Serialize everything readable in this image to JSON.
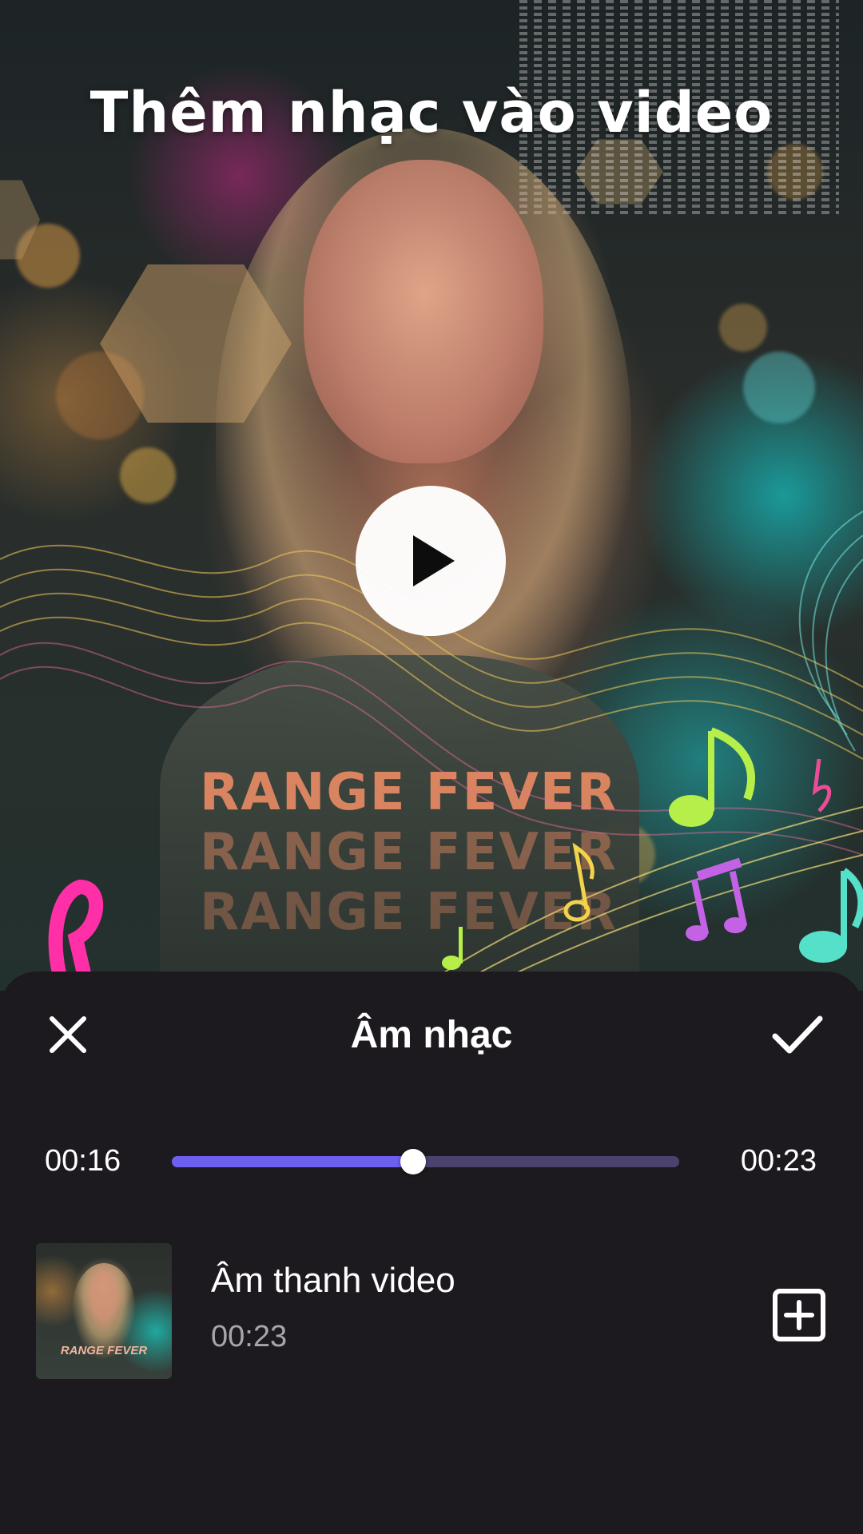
{
  "preview": {
    "headline": "Thêm nhạc vào video",
    "shirt_text": "RANGE FEVER",
    "play_icon": "play-icon"
  },
  "sheet": {
    "title": "Âm nhạc",
    "close_icon": "close-icon",
    "confirm_icon": "checkmark-icon"
  },
  "player": {
    "current_time": "00:16",
    "total_time": "00:23",
    "progress_fraction": 0.475,
    "accent_color": "#6d5ff0",
    "track_color": "#4b436e"
  },
  "audio_items": [
    {
      "name": "Âm thanh video",
      "duration": "00:23",
      "add_icon": "add-box-icon"
    }
  ],
  "colors": {
    "sheet_background": "#1c1a1f",
    "text_primary": "#ffffff",
    "text_secondary": "#a8a6ad"
  }
}
